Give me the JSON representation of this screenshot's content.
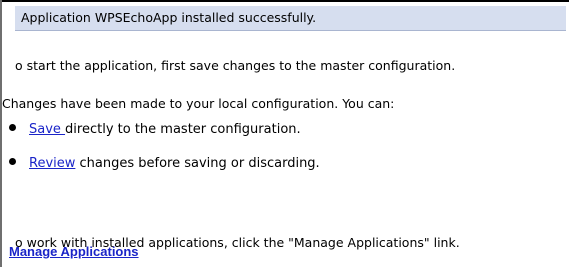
{
  "status": {
    "message": "Application WPSEchoApp installed successfully."
  },
  "instructions": {
    "start_text": "o start the application, first save changes to the master configuration.",
    "changes_text": "Changes have been made to your local configuration. You can:",
    "save_link": "Save ",
    "save_rest": "directly to the master configuration.",
    "review_link": "Review",
    "review_rest": " changes before saving or discarding.",
    "work_text": "o work with installed applications, click the \"Manage Applications\" link."
  },
  "links": {
    "manage_applications": "Manage Applications"
  },
  "colors": {
    "status_background": "#d6deef",
    "link": "#1a24c8"
  }
}
